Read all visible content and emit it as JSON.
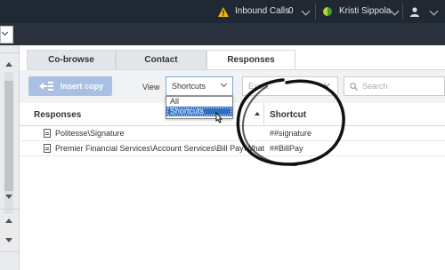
{
  "topbar": {
    "inbound_calls_label": "Inbound Calls",
    "inbound_calls_count": "0",
    "user_name": "Kristi Sippola"
  },
  "tabs": [
    {
      "label": "Co-browse"
    },
    {
      "label": "Contact"
    },
    {
      "label": "Responses"
    }
  ],
  "toolbar": {
    "insert_label": "Insert copy",
    "view_label": "View",
    "view_value": "Shortcuts",
    "exact_placeholder": "Exact",
    "search_placeholder": "Search"
  },
  "view_options": [
    "All",
    "Shortcuts"
  ],
  "table": {
    "headers": [
      "Responses",
      "Shortcut"
    ],
    "rows": [
      {
        "name": "Politesse\\Signature",
        "shortcut": "##signature"
      },
      {
        "name": "Premier Financial Services\\Account Services\\Bill Pay\\What is ...",
        "shortcut": "##BillPay"
      }
    ]
  },
  "colors": {
    "topbar_bg": "#202833",
    "accent": "#2f6fc2",
    "status_available": "#b8d432",
    "warning": "#f2b50c"
  }
}
